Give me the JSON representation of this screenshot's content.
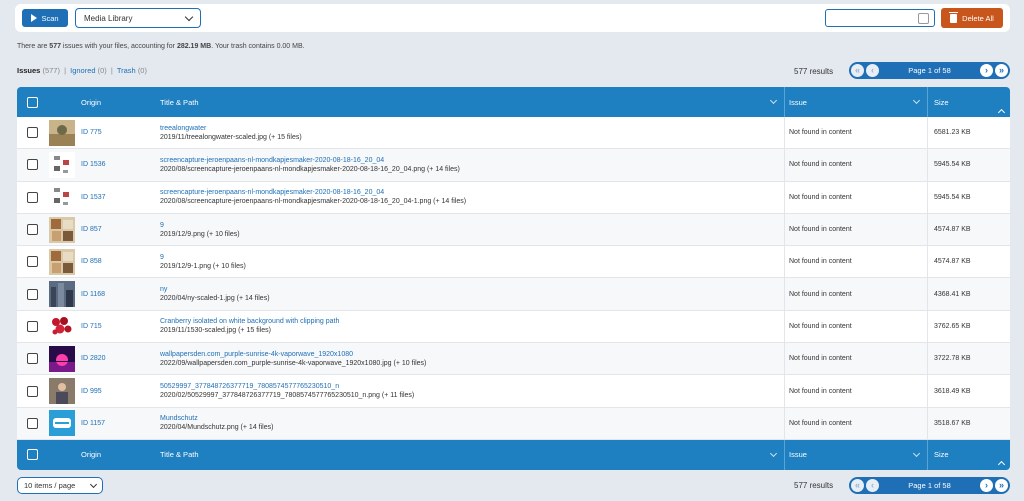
{
  "toolbar": {
    "scan_label": "Scan",
    "source_select": "Media Library",
    "search_placeholder": "",
    "delete_all_label": "Delete All"
  },
  "summary": {
    "prefix": "There are ",
    "issue_count": "577",
    "middle": " issues with your files, accounting for ",
    "size": "282.19 MB",
    "suffix": ". Your trash contains 0.00 MB."
  },
  "tabs": [
    {
      "label": "Issues",
      "count": "(577)"
    },
    {
      "label": "Ignored",
      "count": "(0)"
    },
    {
      "label": "Trash",
      "count": "(0)"
    }
  ],
  "pagination": {
    "results": "577 results",
    "page_text": "Page 1 of 58",
    "first": "«",
    "prev": "‹",
    "next": "›",
    "last": "»"
  },
  "columns": {
    "origin": "Origin",
    "title": "Title & Path",
    "issue": "Issue",
    "size": "Size"
  },
  "rows": [
    {
      "id": "ID 775",
      "title": "treealongwater",
      "path": "2019/11/treealongwater-scaled.jpg (+ 15 files)",
      "issue": "Not found in content",
      "size": "6581.23 KB",
      "thumb": "landscape"
    },
    {
      "id": "ID 1536",
      "title": "screencapture-jeroenpaans-nl-mondkapjesmaker-2020-08-18-16_20_04",
      "path": "2020/08/screencapture-jeroenpaans-nl-mondkapjesmaker-2020-08-18-16_20_04.png (+ 14 files)",
      "issue": "Not found in content",
      "size": "5945.54 KB",
      "thumb": "screenshot"
    },
    {
      "id": "ID 1537",
      "title": "screencapture-jeroenpaans-nl-mondkapjesmaker-2020-08-18-16_20_04",
      "path": "2020/08/screencapture-jeroenpaans-nl-mondkapjesmaker-2020-08-18-16_20_04-1.png (+ 14 files)",
      "issue": "Not found in content",
      "size": "5945.54 KB",
      "thumb": "screenshot"
    },
    {
      "id": "ID 857",
      "title": "9",
      "path": "2019/12/9.png (+ 10 files)",
      "issue": "Not found in content",
      "size": "4574.87 KB",
      "thumb": "collage"
    },
    {
      "id": "ID 858",
      "title": "9",
      "path": "2019/12/9-1.png (+ 10 files)",
      "issue": "Not found in content",
      "size": "4574.87 KB",
      "thumb": "collage"
    },
    {
      "id": "ID 1168",
      "title": "ny",
      "path": "2020/04/ny-scaled-1.jpg (+ 14 files)",
      "issue": "Not found in content",
      "size": "4368.41 KB",
      "thumb": "city"
    },
    {
      "id": "ID 715",
      "title": "Cranberry isolated on white background with clipping path",
      "path": "2019/11/1530-scaled.jpg (+ 15 files)",
      "issue": "Not found in content",
      "size": "3762.65 KB",
      "thumb": "cranberry"
    },
    {
      "id": "ID 2820",
      "title": "wallpapersden.com_purple-sunrise-4k-vaporwave_1920x1080",
      "path": "2022/09/wallpapersden.com_purple-sunrise-4k-vaporwave_1920x1080.jpg (+ 10 files)",
      "issue": "Not found in content",
      "size": "3722.78 KB",
      "thumb": "vaporwave"
    },
    {
      "id": "ID 995",
      "title": "50529997_377848726377719_7808574577765230510_n",
      "path": "2020/02/50529997_377848726377719_7808574577765230510_n.png (+ 11 files)",
      "issue": "Not found in content",
      "size": "3618.49 KB",
      "thumb": "portrait"
    },
    {
      "id": "ID 1157",
      "title": "Mundschutz",
      "path": "2020/04/Mundschutz.png (+ 14 files)",
      "issue": "Not found in content",
      "size": "3518.67 KB",
      "thumb": "mask"
    }
  ],
  "per_page": "10 items / page"
}
